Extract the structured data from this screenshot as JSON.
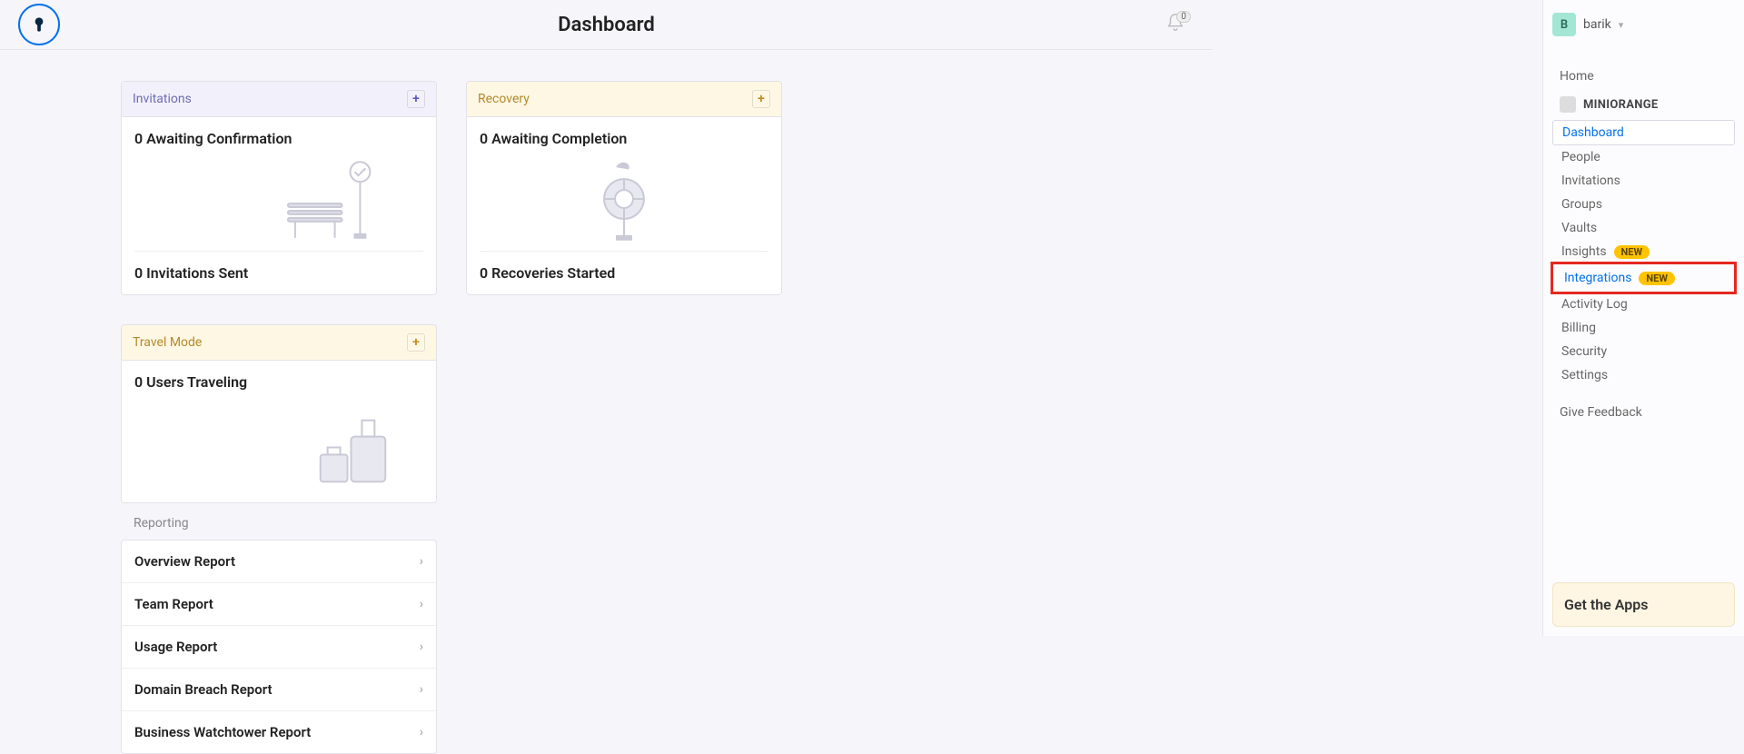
{
  "header": {
    "title": "Dashboard",
    "notification_count": "0"
  },
  "user": {
    "initial": "B",
    "name": "barik"
  },
  "sidebar": {
    "home": "Home",
    "org": "MINIORANGE",
    "items": [
      {
        "label": "Dashboard",
        "active": true
      },
      {
        "label": "People"
      },
      {
        "label": "Invitations"
      },
      {
        "label": "Groups"
      },
      {
        "label": "Vaults"
      },
      {
        "label": "Insights",
        "badge": "NEW"
      },
      {
        "label": "Integrations",
        "badge": "NEW",
        "highlighted": true
      },
      {
        "label": "Activity Log"
      },
      {
        "label": "Billing"
      },
      {
        "label": "Security"
      },
      {
        "label": "Settings"
      }
    ],
    "feedback": "Give Feedback",
    "get_apps": "Get the Apps"
  },
  "cards": {
    "invitations": {
      "title": "Invitations",
      "line1": "0 Awaiting Confirmation",
      "line2": "0 Invitations Sent"
    },
    "recovery": {
      "title": "Recovery",
      "line1": "0 Awaiting Completion",
      "line2": "0 Recoveries Started"
    },
    "travel": {
      "title": "Travel Mode",
      "line1": "0 Users Traveling"
    }
  },
  "reporting": {
    "title": "Reporting",
    "items": [
      "Overview Report",
      "Team Report",
      "Usage Report",
      "Domain Breach Report",
      "Business Watchtower Report"
    ]
  }
}
